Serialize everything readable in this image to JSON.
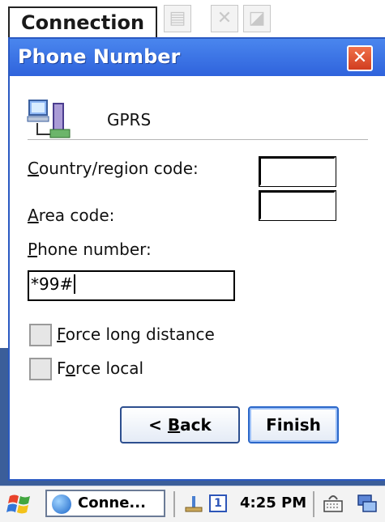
{
  "background": {
    "menu_label": "Connection"
  },
  "dialog": {
    "title": "Phone Number",
    "close_label": "✕",
    "connection_name": "GPRS",
    "country_label_ul": "C",
    "country_label_rest": "ountry/region code:",
    "area_label_ul": "A",
    "area_label_rest": "rea code:",
    "phone_label_ul": "P",
    "phone_label_rest": "hone number:",
    "phone_value": "*99#",
    "force_long_ul": "F",
    "force_long_rest": "orce long distance",
    "force_local_pre": "F",
    "force_local_ul": "o",
    "force_local_rest": "rce local",
    "back_pre": "< ",
    "back_ul": "B",
    "back_rest": "ack",
    "finish_label": "Finish"
  },
  "taskbar": {
    "task_label": "Conne...",
    "input_badge": "1",
    "clock": "4:25 PM"
  },
  "colors": {
    "titlebar": "#2f63dc",
    "close": "#d13d1f",
    "desktop": "#3b5e9a"
  }
}
